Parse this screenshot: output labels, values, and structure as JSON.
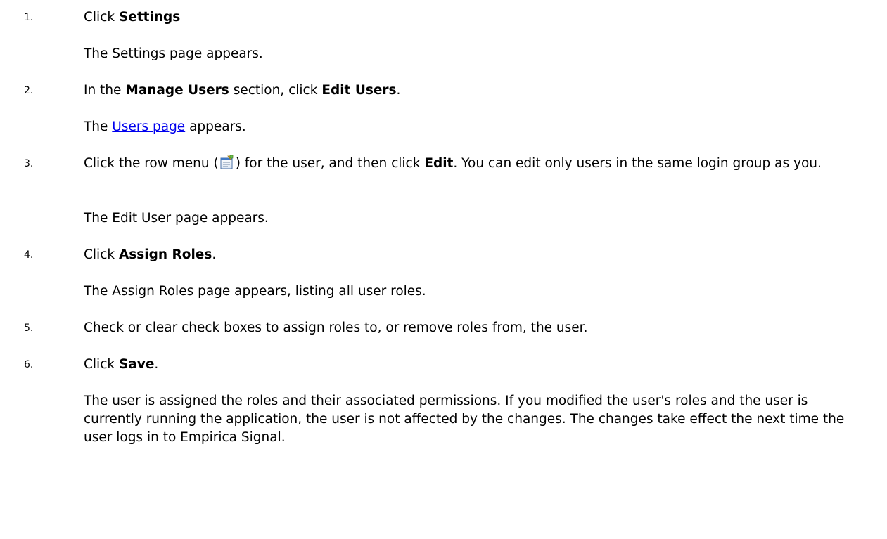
{
  "steps": [
    {
      "num": "1.",
      "pre": "Click ",
      "bold": "Settings",
      "result": "The Settings page appears."
    },
    {
      "num": "2.",
      "t1": "In the ",
      "b1": "Manage Users",
      "t2": " section, click ",
      "b2": "Edit Users",
      "t3": ".",
      "result_pre": "The ",
      "result_link": "Users page",
      "result_post": " appears."
    },
    {
      "num": "3.",
      "t1": "Click the row menu (",
      "t2": ") for the user, and then click ",
      "b1": "Edit",
      "t3": ". You can edit only users in the same login group as you.",
      "icon": "row-menu-icon",
      "result": "The Edit User page appears."
    },
    {
      "num": "4.",
      "pre": "Click ",
      "bold": "Assign Roles",
      "post": ".",
      "result": "The Assign Roles page appears, listing all user roles."
    },
    {
      "num": "5.",
      "text": "Check or clear check boxes to assign roles to, or remove roles from, the user."
    },
    {
      "num": "6.",
      "pre": "Click ",
      "bold": "Save",
      "post": ".",
      "result": "The user is assigned the roles and their associated permissions. If you modified the user's roles and the user is currently running the application, the user is not affected by the changes. The changes take effect the next time the user logs in to Empirica Signal."
    }
  ]
}
